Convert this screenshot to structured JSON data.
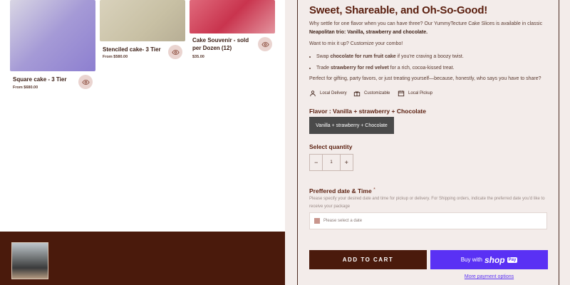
{
  "products": [
    {
      "name": "Square cake - 3 Tier",
      "price": "From $680.00"
    },
    {
      "name": "Stenciled cake- 3 Tier",
      "price": "From $580.00"
    },
    {
      "name": "Cake Souvenir - sold per Dozen (12)",
      "price": "$35.00"
    }
  ],
  "detail": {
    "title": "Sweet, Shareable, and Oh-So-Good!",
    "intro_1": "Why settle for one flavor when you can have three? Our YummyTecture Cake Slices is available in classic ",
    "intro_bold": "Neapolitan trio: Vanilla, strawberry and chocolate.",
    "mix_line": "Want to mix it up? Customize your combo!",
    "combo": [
      {
        "pre": "Swap ",
        "bold": "chocolate for rum fruit cake",
        "post": " if you're craving a boozy twist."
      },
      {
        "pre": "Trade ",
        "bold": "strawberry for red velvet",
        "post": " for a rich, cocoa-kissed treat."
      }
    ],
    "perfect_line": "Perfect for gifting, party favors, or just treating yourself—because, honestly, who says you have to share?",
    "features": [
      "Local Delivery",
      "Customizable",
      "Local Pickup"
    ],
    "flavor_label": "Flavor : Vanilla + strawberry + Chocolate",
    "flavor_option": "Vanilla + strawberry + Chocolate",
    "quantity_label": "Select quantity",
    "quantity_value": "1",
    "date_label": "Preffered date & Time",
    "date_required": "*",
    "date_help": "Please specify your desired date and time for pickup or delivery. For Shipping orders, indicate the preferred date you'd like to receive your package",
    "date_placeholder": "Please select a date",
    "add_to_cart": "ADD TO CART",
    "buy_with": "Buy with",
    "shop_logo": "shop",
    "shop_pay": "Pay",
    "more_options": "More payment options"
  },
  "colors": {
    "accent": "#4a1a0c",
    "shop": "#5a31f4",
    "panel_bg": "#f3ecea",
    "title": "#5a1e0e"
  }
}
